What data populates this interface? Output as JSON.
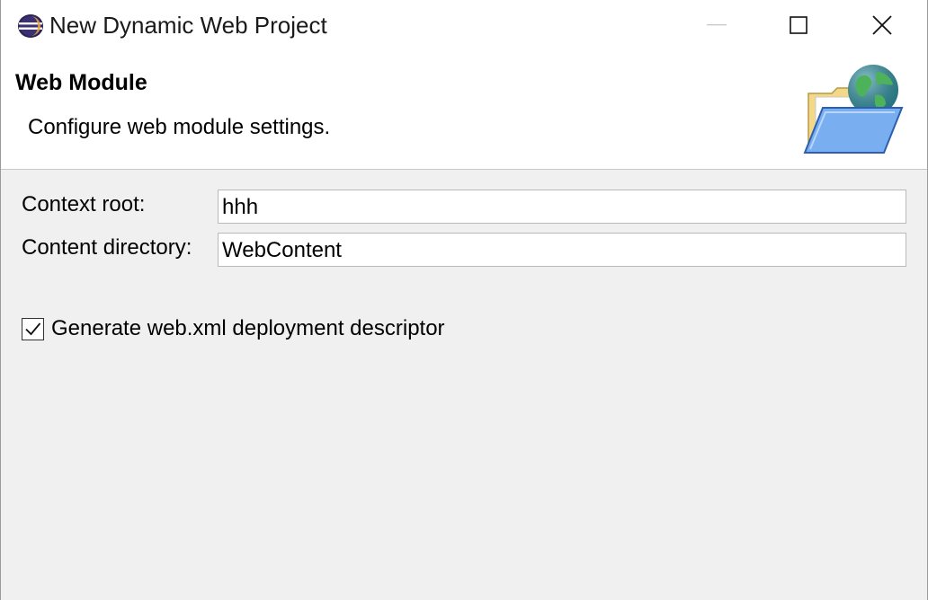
{
  "window": {
    "title": "New Dynamic Web Project",
    "app_icon": "eclipse-icon",
    "controls": {
      "minimize_icon": "minimize-icon",
      "maximize_icon": "maximize-icon",
      "close_icon": "close-icon"
    }
  },
  "header": {
    "title": "Web Module",
    "description": "Configure web module settings.",
    "image": "web-folder-globe-icon"
  },
  "form": {
    "context_root": {
      "label": "Context root:",
      "value": "hhh"
    },
    "content_directory": {
      "label": "Content directory:",
      "value": "WebContent"
    },
    "generate_web_xml": {
      "label": "Generate web.xml deployment descriptor",
      "checked": true
    }
  }
}
